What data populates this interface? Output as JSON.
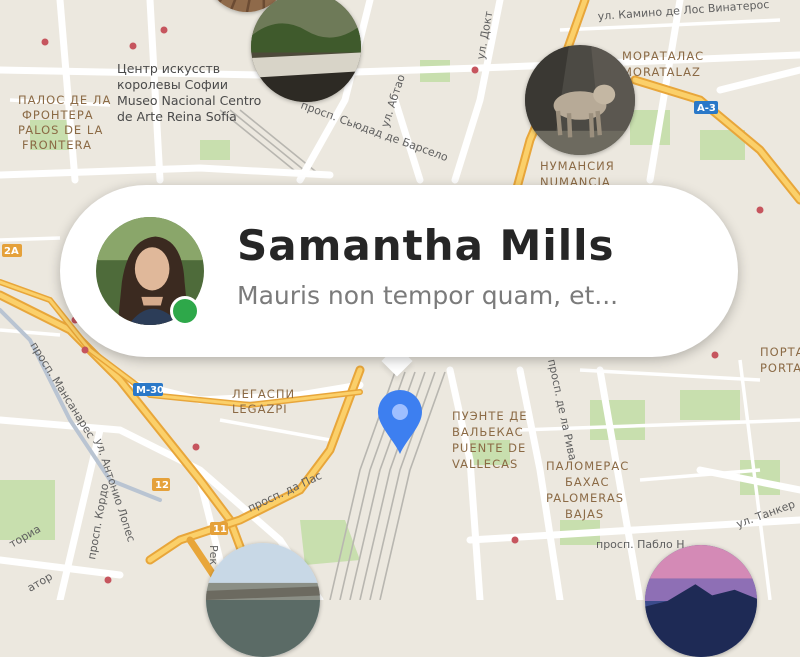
{
  "contact": {
    "name": "Samantha Mills",
    "message": "Mauris non tempor quam, et...",
    "online_color": "#2ea84a",
    "avatar_icon": "woman-portrait",
    "status_icon": "online-status-dot"
  },
  "map": {
    "pin_color": "#3d7ff0",
    "pin_icon": "location-pin-icon",
    "labels": {
      "museum_1": "Центр искусств",
      "museum_2": "королевы Софии",
      "museum_3": "Museo Nacional Centro",
      "museum_4": "de Arte Reina Sofía",
      "palos_1": "ПАЛОС ДЕ ЛА",
      "palos_2": "ФРОНТЕРА",
      "palos_3": "PALOS DE LA",
      "palos_4": "FRONTERA",
      "moratalaz_1": "МОРАТАЛАС",
      "moratalaz_2": "MORATALAZ",
      "numancia_1": "НУМАНСИЯ",
      "numancia_2": "NUMANCIA",
      "legazpi_1": "ЛЕГАСПИ",
      "legazpi_2": "LEGAZPI",
      "vallecas_1": "ПУЭНТЕ ДЕ",
      "vallecas_2": "ВАЛЬЕКАС",
      "vallecas_3": "PUENTE DE",
      "vallecas_4": "VALLECAS",
      "palomeras_1": "ПАЛОМЕРАС",
      "palomeras_2": "БАХАС",
      "palomeras_3": "PALOMERAS",
      "palomeras_4": "BAJAS",
      "portal_1": "ПОРТА",
      "portal_2": "PORTA",
      "st_camino": "ул. Камино де Лос Винатерос",
      "st_dokt": "ул. Докт",
      "st_abtao": "ул. Абтао",
      "st_seudad": "просп. Сьюдад де Барсело",
      "st_manzanares": "просп. Мансанарес",
      "st_antonio": "ул. Антонио Лопес",
      "st_paz": "просп. да Пас",
      "st_riva": "просп. де ла Рива",
      "st_pablo": "просп. Пабло Н",
      "st_tanker": "ул. Танкер",
      "st_kordon": "просп. Кордо",
      "st_victor": "ториа",
      "st_ator": "атор",
      "st_rek": "Рек"
    },
    "badges": {
      "a3": "A-3",
      "m30": "M-30",
      "a2a": "2A",
      "n12": "12",
      "n11": "11"
    }
  }
}
